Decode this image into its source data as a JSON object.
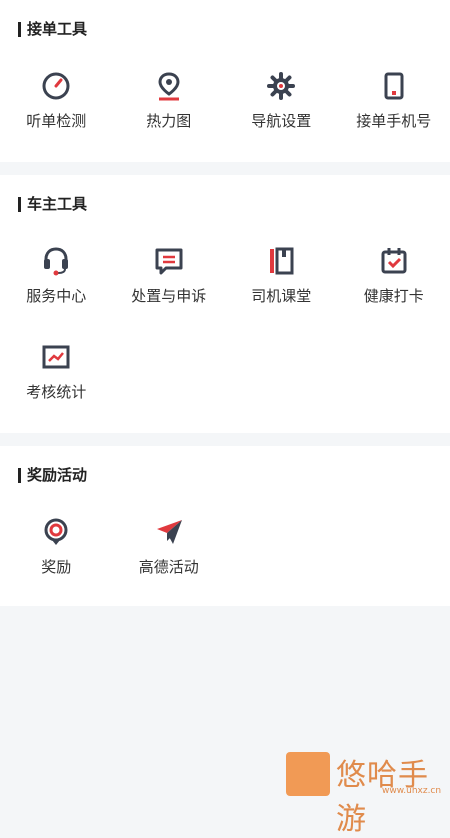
{
  "sections": [
    {
      "title": "接单工具",
      "items": [
        {
          "label": "听单检测",
          "icon": "gauge-icon"
        },
        {
          "label": "热力图",
          "icon": "location-pin-icon"
        },
        {
          "label": "导航设置",
          "icon": "gear-icon"
        },
        {
          "label": "接单手机号",
          "icon": "phone-icon"
        }
      ]
    },
    {
      "title": "车主工具",
      "items": [
        {
          "label": "服务中心",
          "icon": "headset-icon"
        },
        {
          "label": "处置与申诉",
          "icon": "chat-bubble-icon"
        },
        {
          "label": "司机课堂",
          "icon": "book-icon"
        },
        {
          "label": "健康打卡",
          "icon": "calendar-check-icon"
        },
        {
          "label": "考核统计",
          "icon": "chart-icon"
        }
      ]
    },
    {
      "title": "奖励活动",
      "items": [
        {
          "label": "奖励",
          "icon": "medal-icon"
        },
        {
          "label": "高德活动",
          "icon": "paper-plane-icon"
        }
      ]
    }
  ],
  "watermark": {
    "text": "悠哈手游",
    "url": "www.uhxz.cn"
  },
  "colors": {
    "dark": "#3b4250",
    "accent": "#e0393e",
    "bg": "#f4f6f8"
  }
}
